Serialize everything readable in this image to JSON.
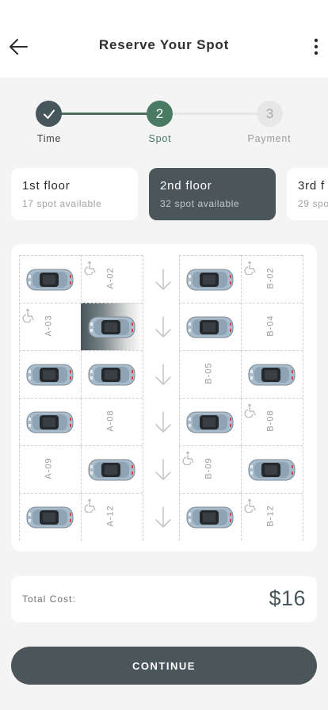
{
  "header": {
    "title": "Reserve Your Spot",
    "back_icon": "arrow-left-icon",
    "menu_icon": "more-vertical-icon"
  },
  "stepper": {
    "steps": [
      {
        "label": "Time",
        "number": "1",
        "state": "done",
        "icon": "check-icon"
      },
      {
        "label": "Spot",
        "number": "2",
        "state": "active"
      },
      {
        "label": "Payment",
        "number": "3",
        "state": "upcoming"
      }
    ]
  },
  "floors": [
    {
      "name": "1st floor",
      "availability": "17 spot available",
      "selected": false
    },
    {
      "name": "2nd floor",
      "availability": "32 spot available",
      "selected": true
    },
    {
      "name": "3rd f",
      "availability": "29 spo",
      "selected": false
    }
  ],
  "parking_map": {
    "lane_icon": "arrow-down-icon",
    "rows": [
      {
        "a_left": {
          "type": "car"
        },
        "a_right": {
          "type": "label",
          "label": "A-02",
          "accessible": true
        },
        "b_left": {
          "type": "car"
        },
        "b_right": {
          "type": "label",
          "label": "B-02",
          "accessible": true
        }
      },
      {
        "a_left": {
          "type": "label",
          "label": "A-03",
          "accessible": true
        },
        "a_right": {
          "type": "selected-car"
        },
        "b_left": {
          "type": "car"
        },
        "b_right": {
          "type": "label",
          "label": "B-04",
          "accessible": false
        }
      },
      {
        "a_left": {
          "type": "car"
        },
        "a_right": {
          "type": "car"
        },
        "b_left": {
          "type": "label",
          "label": "B-05",
          "accessible": false
        },
        "b_right": {
          "type": "car"
        }
      },
      {
        "a_left": {
          "type": "car"
        },
        "a_right": {
          "type": "label",
          "label": "A-08",
          "accessible": false
        },
        "b_left": {
          "type": "car"
        },
        "b_right": {
          "type": "label",
          "label": "B-08",
          "accessible": true
        }
      },
      {
        "a_left": {
          "type": "label",
          "label": "A-09",
          "accessible": false
        },
        "a_right": {
          "type": "car"
        },
        "b_left": {
          "type": "label",
          "label": "B-09",
          "accessible": true
        },
        "b_right": {
          "type": "car"
        }
      },
      {
        "a_left": {
          "type": "car"
        },
        "a_right": {
          "type": "label",
          "label": "A-12",
          "accessible": true
        },
        "b_left": {
          "type": "car"
        },
        "b_right": {
          "type": "label",
          "label": "B-12",
          "accessible": true
        }
      }
    ]
  },
  "cost": {
    "label": "Total Cost:",
    "value": "$16"
  },
  "continue_label": "CONTINUE",
  "colors": {
    "primary_dark": "#4a5659",
    "accent_green": "#4a7a61",
    "background": "#f4f4f4"
  }
}
